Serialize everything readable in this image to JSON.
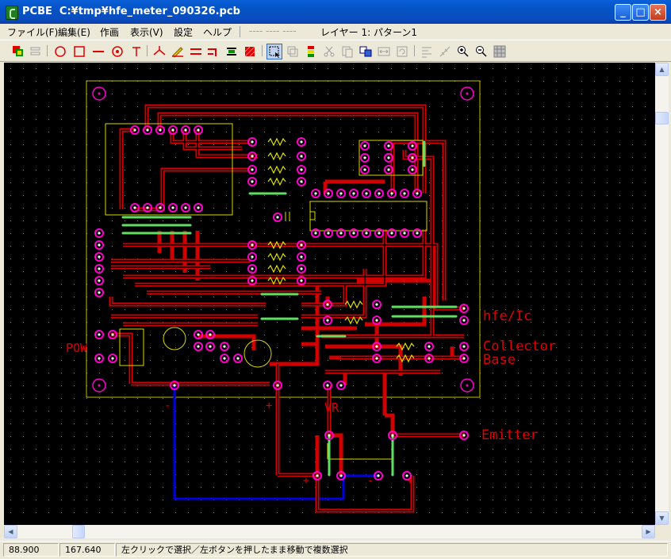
{
  "window": {
    "app": "PCBE",
    "path": "C:¥tmp¥hfe_meter_090326.pcb"
  },
  "menu": [
    "ファイル(F)",
    "編集(E)",
    "作画",
    "表示(V)",
    "設定",
    "ヘルプ"
  ],
  "layer": {
    "inactive": "---- ---- ----",
    "active": "レイヤー 1: パターン1"
  },
  "toolbar": {
    "colors": {
      "red": "#E00000",
      "green": "#008000",
      "yellow": "#E0E000"
    },
    "buttons": [
      "layers-icon",
      "layers-disabled-icon",
      "circle-icon",
      "rect-icon",
      "line-icon",
      "pad-icon",
      "text-icon",
      "junction-icon",
      "pencil-icon",
      "double-line-icon",
      "corner-line-icon",
      "via-line-icon",
      "fill-icon",
      "select-icon",
      "copy-icon",
      "group-icon",
      "cut-icon",
      "paste-icon",
      "swap-icon",
      "mirror-icon",
      "rotate-icon",
      "sort-icon",
      "measure-icon",
      "zoom-in-icon",
      "zoom-out-icon",
      "grid-icon"
    ]
  },
  "pcb": {
    "colors": {
      "trace_top": "#E00000",
      "trace_bottom": "#0000E0",
      "silk": "#E0E000",
      "pad": "#FF00CC",
      "jumper": "#80FF80",
      "board": "#C0C000"
    },
    "labels": {
      "hfe": "hfe/Ic",
      "collector": "Collector",
      "base": "Base",
      "emitter": "Emitter",
      "power": "POW",
      "vr": "VR",
      "minus1": "-",
      "plus1": "+",
      "plus2": "+",
      "minus2": "-",
      "plus3": "+"
    }
  },
  "status": {
    "x": "88.900",
    "y": "167.640",
    "message": "左クリックで選択／左ボタンを押したまま移動で複数選択"
  }
}
